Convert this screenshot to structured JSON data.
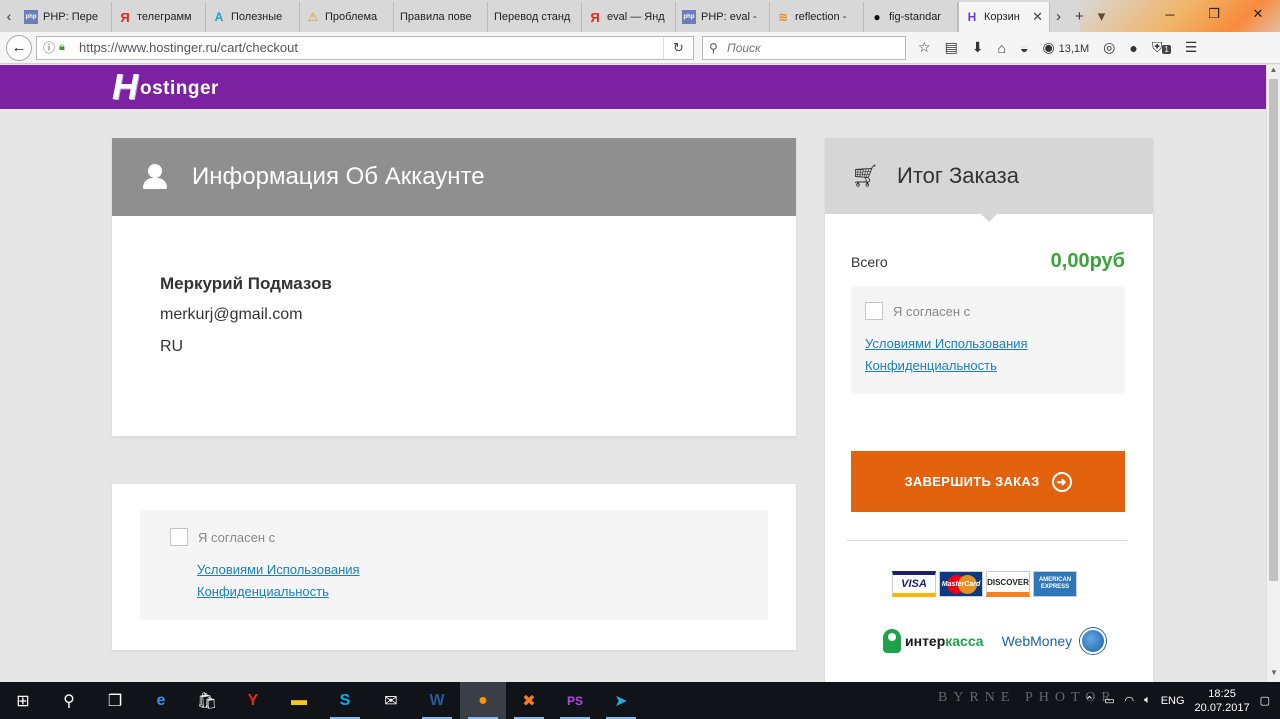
{
  "browser": {
    "tabs": [
      {
        "favicon": "php",
        "title": "PHP: Пере"
      },
      {
        "favicon": "ya",
        "title": "телеграмм"
      },
      {
        "favicon": "a",
        "title": "Полезные"
      },
      {
        "favicon": "warn",
        "title": "Проблема"
      },
      {
        "favicon": "none",
        "title": "Правила пове"
      },
      {
        "favicon": "none",
        "title": "Перевод станд"
      },
      {
        "favicon": "ya",
        "title": "eval — Янд"
      },
      {
        "favicon": "php",
        "title": "PHP: eval -"
      },
      {
        "favicon": "so",
        "title": "reflection -"
      },
      {
        "favicon": "gh",
        "title": "fig-standar"
      },
      {
        "favicon": "h",
        "title": "Корзин"
      }
    ],
    "url": "https://www.hostinger.ru/cart/checkout",
    "search_placeholder": "Поиск",
    "memory": "13,1M",
    "ublock_badge": "1"
  },
  "page": {
    "logo": {
      "first": "H",
      "rest": "ostinger"
    },
    "account": {
      "title": "Информация Об Аккаунте",
      "name": "Меркурий Подмазов",
      "email": "merkurj@gmail.com",
      "country": "RU"
    },
    "terms": {
      "agree": "Я согласен с",
      "link_terms": "Условиями Использования",
      "link_privacy": "Конфиденциальность"
    },
    "summary": {
      "title": "Итог Заказа",
      "total_label": "Всего",
      "total_value": "0,00руб",
      "finish_button": "ЗАВЕРШИТЬ ЗАКАЗ"
    },
    "payments": {
      "visa": "VISA",
      "mastercard": "MasterCard",
      "discover": "DISCOVER",
      "amex": "AMERICAN EXPRESS",
      "interkassa_a": "интер",
      "interkassa_b": "касса",
      "webmoney": "WebMoney"
    }
  },
  "taskbar": {
    "lang": "ENG",
    "time": "18:25",
    "date": "20.07.2017",
    "watermark": "BYRNE PHOTOR"
  },
  "colors": {
    "brand": "#7d21a3",
    "accent_button": "#e2620d",
    "price": "#3aa43a",
    "link": "#1a7fc1"
  }
}
